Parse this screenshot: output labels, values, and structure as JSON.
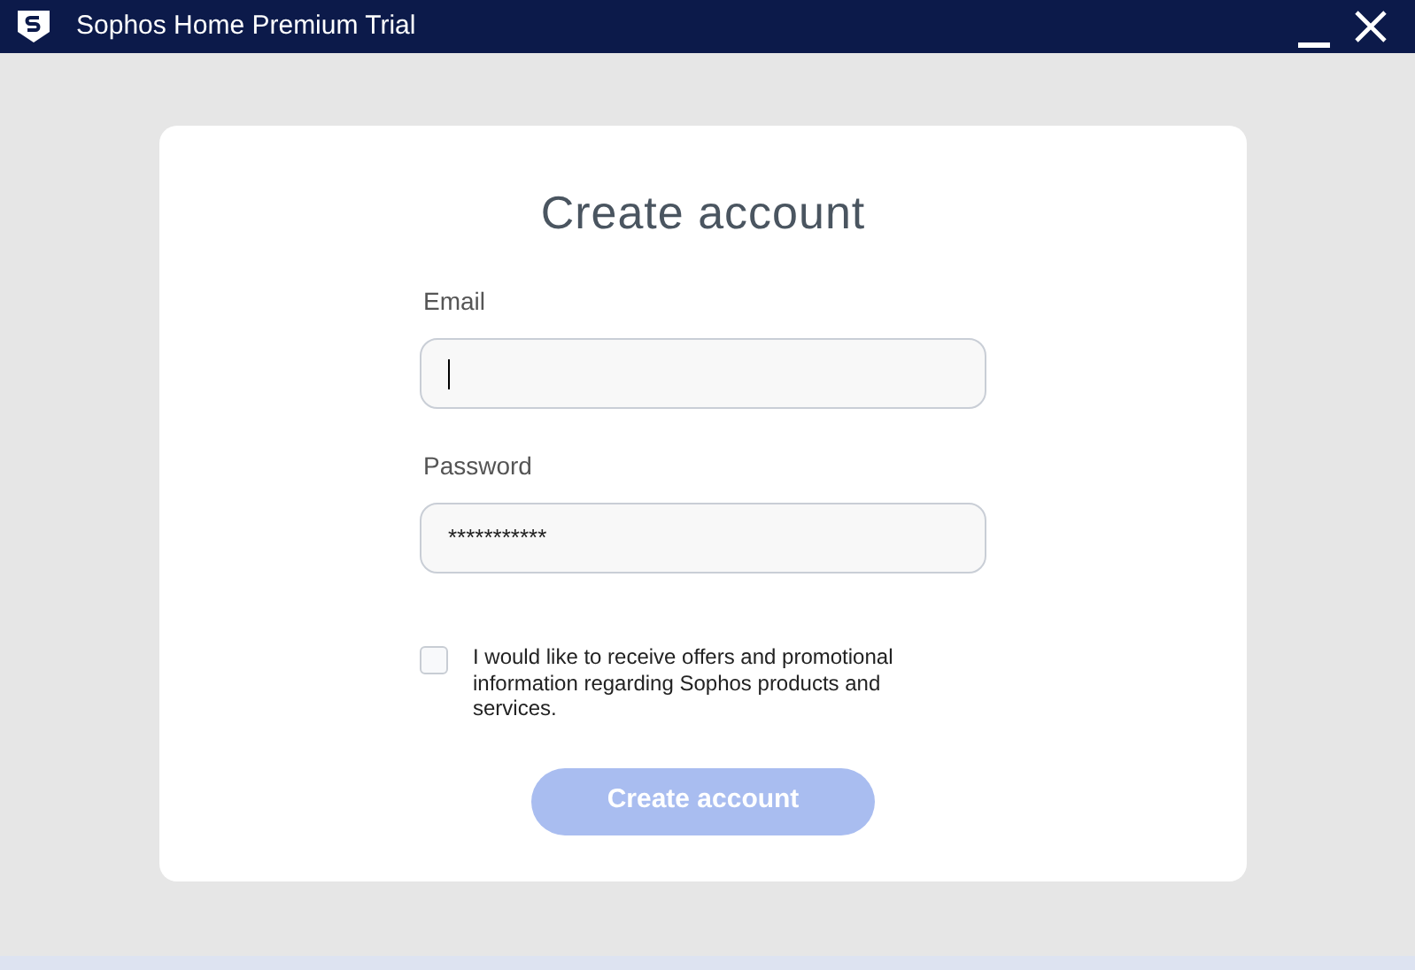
{
  "window": {
    "title": "Sophos Home Premium Trial"
  },
  "form": {
    "heading": "Create account",
    "fields": [
      {
        "label": "Email",
        "focused": true
      },
      {
        "label": "Password",
        "value": "***********",
        "focused": false
      }
    ],
    "consent": {
      "text": "I would like to receive offers and promotional information regarding Sophos products and services.",
      "checked": false
    },
    "submit": {
      "label": "Create account",
      "disabled": true
    }
  }
}
